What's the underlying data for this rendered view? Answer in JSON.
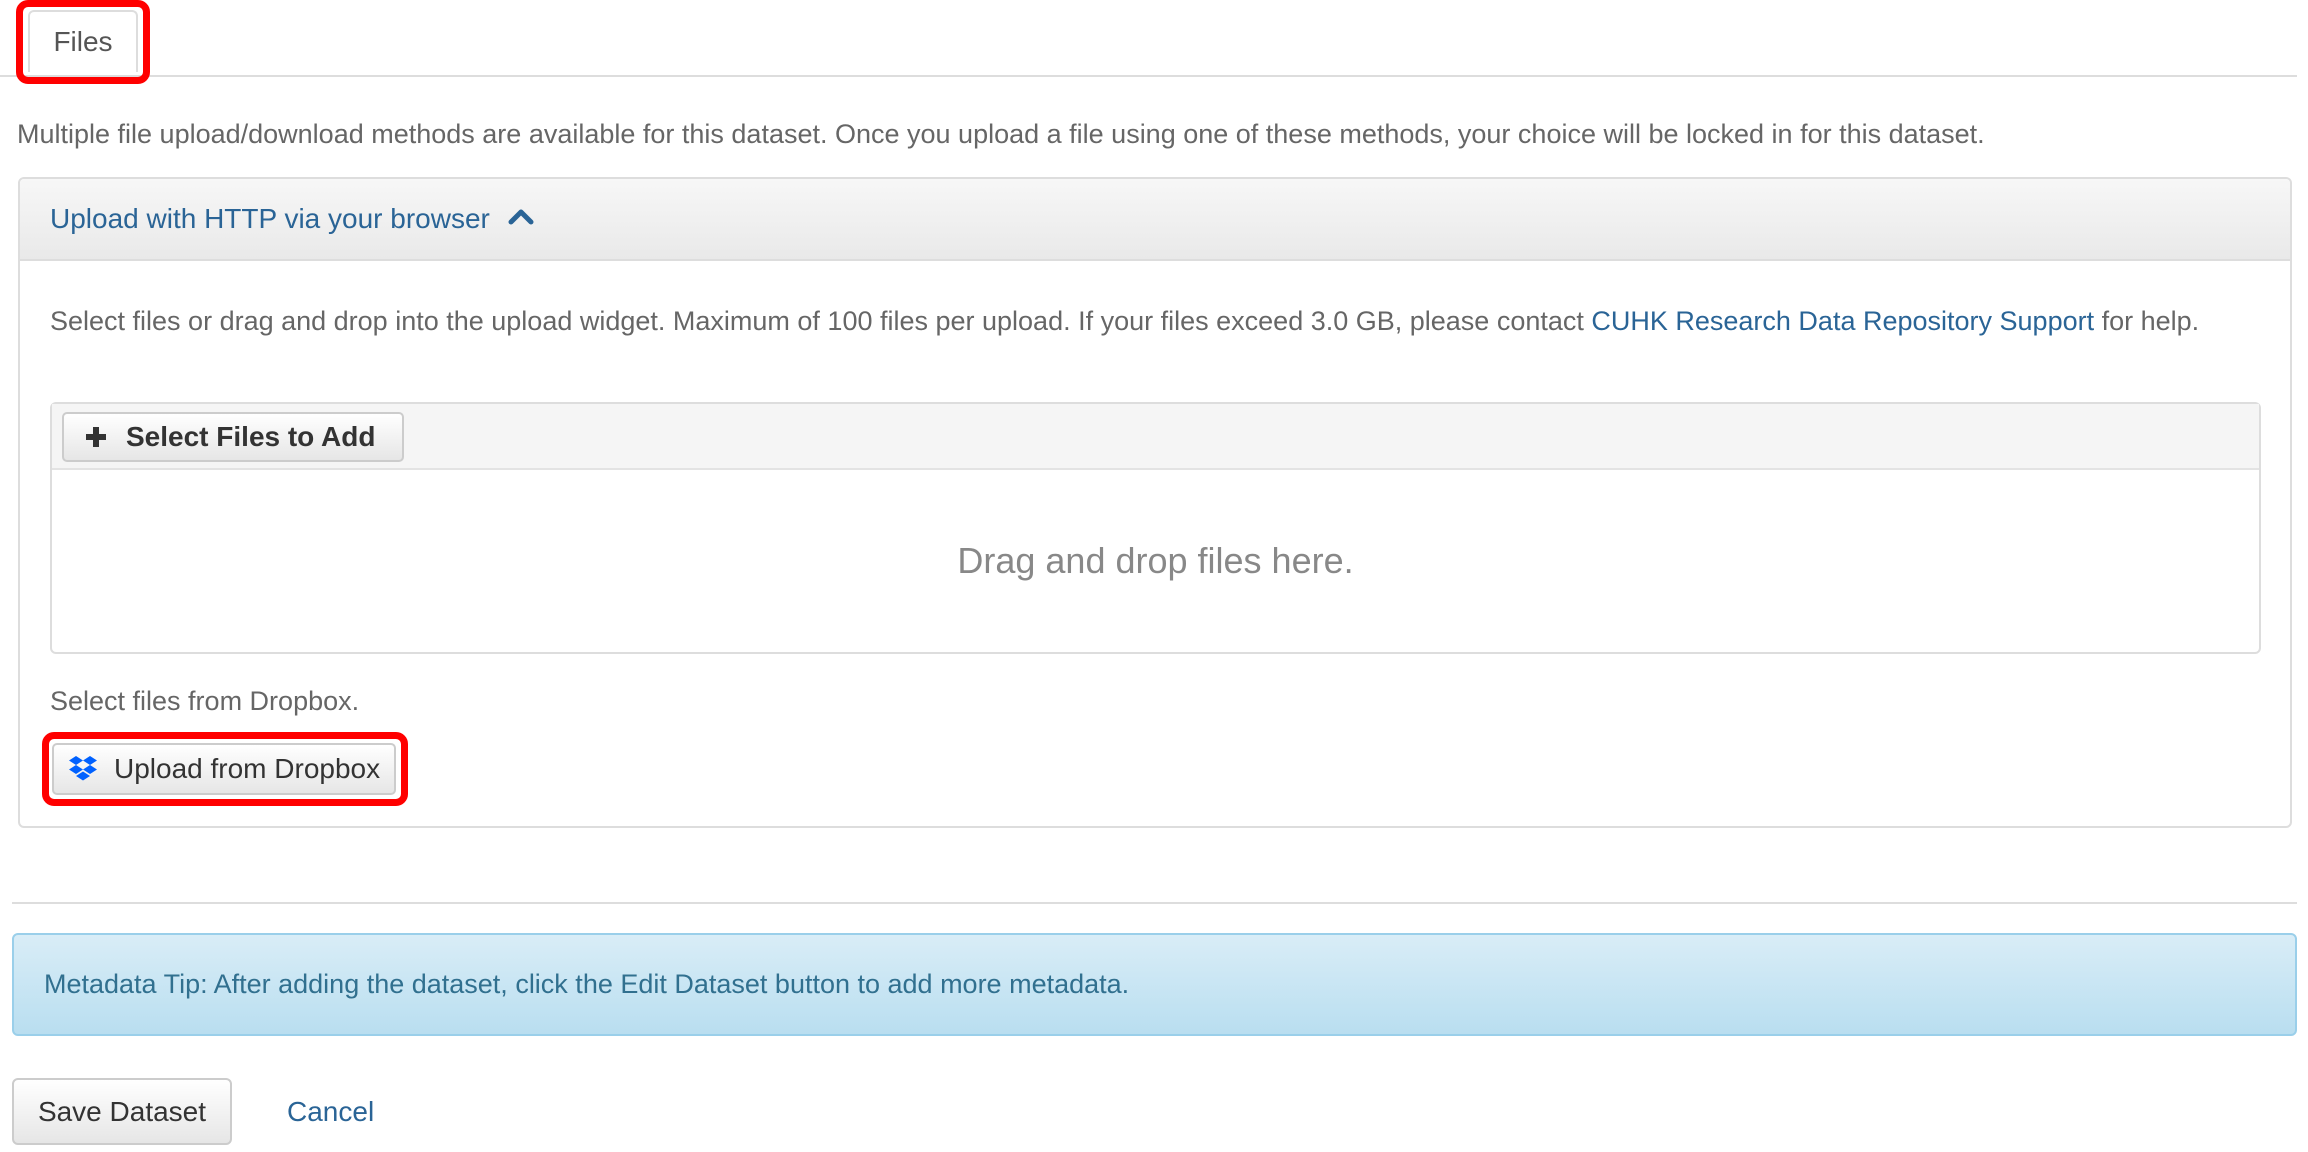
{
  "tabs": {
    "files_label": "Files"
  },
  "intro_text": "Multiple file upload/download methods are available for this dataset. Once you upload a file using one of these methods, your choice will be locked in for this dataset.",
  "upload_panel": {
    "heading": "Upload with HTTP via your browser",
    "heading_icon": "chevron-up-icon",
    "help_before_link": "Select files or drag and drop into the upload widget. Maximum of 100 files per upload. If your files exceed 3.0 GB, please contact ",
    "help_link": "CUHK Research Data Repository Support",
    "help_after_link": " for help.",
    "select_files_label": "Select Files to Add",
    "drop_zone_text": "Drag and drop files here.",
    "dropbox_label": "Select files from Dropbox.",
    "dropbox_button_label": "Upload from Dropbox"
  },
  "alert": {
    "text": "Metadata Tip: After adding the dataset, click the Edit Dataset button to add more metadata."
  },
  "footer": {
    "save_label": "Save Dataset",
    "cancel_label": "Cancel"
  },
  "colors": {
    "link": "#2a6496",
    "highlight": "#ff0000",
    "dropbox_blue": "#0061ff",
    "alert_text": "#31708f"
  }
}
